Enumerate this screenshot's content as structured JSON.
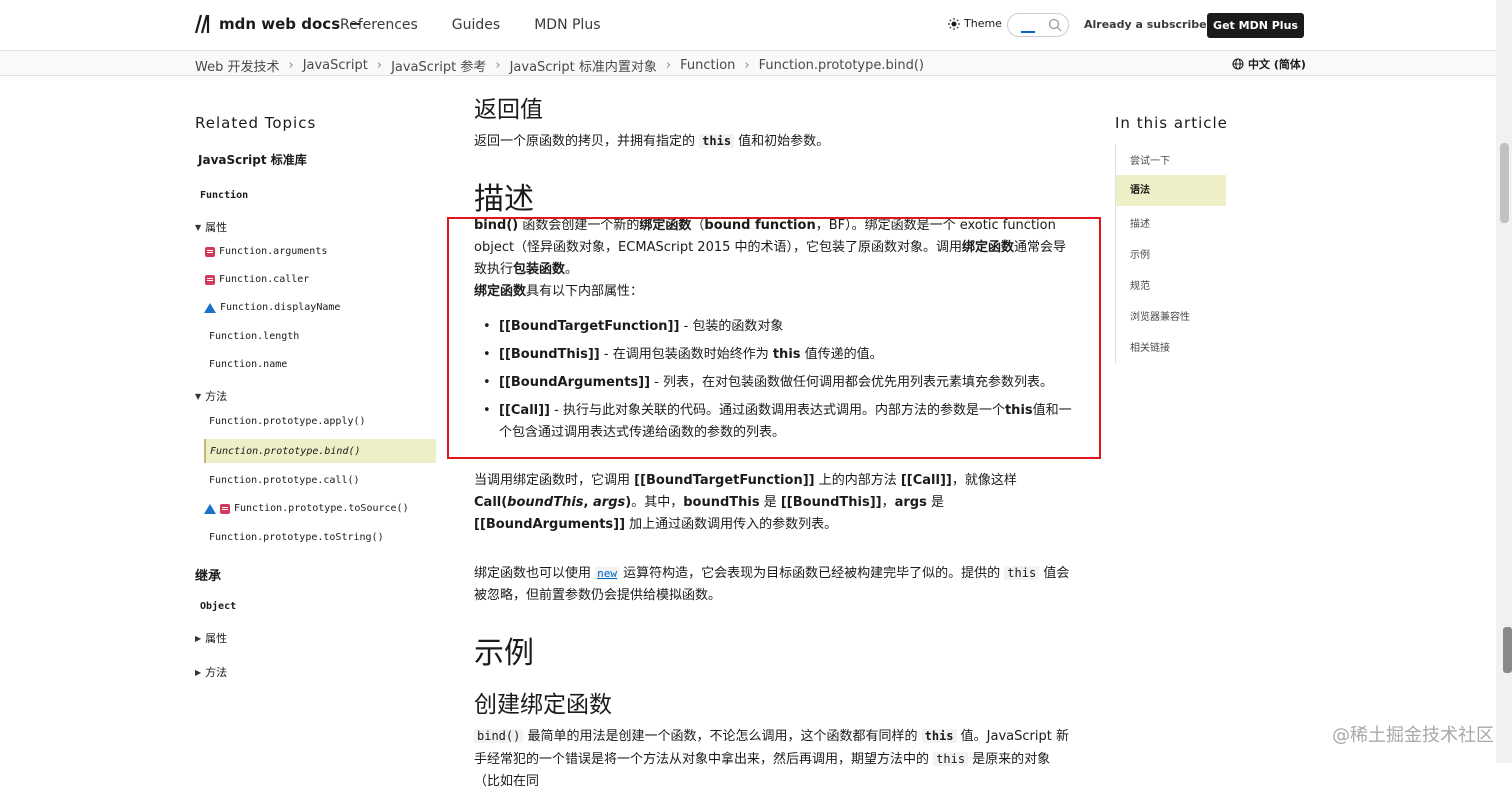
{
  "header": {
    "logo_text": "mdn web docs",
    "nav": [
      "References",
      "Guides",
      "MDN Plus"
    ],
    "theme_label": "Theme",
    "already_subscriber": "Already a subscriber?",
    "get_plus": "Get MDN Plus"
  },
  "breadcrumb": {
    "items": [
      "Web 开发技术",
      "JavaScript",
      "JavaScript 参考",
      "JavaScript 标准内置对象",
      "Function",
      "Function.prototype.bind()"
    ],
    "separator": "›",
    "language": "中文 (简体)"
  },
  "sidebar": {
    "heading": "Related Topics",
    "subheading": "JavaScript 标准库",
    "items": [
      {
        "label": "Function"
      },
      {
        "label": "属性"
      },
      {
        "label": "Function.arguments"
      },
      {
        "label": "Function.caller"
      },
      {
        "label": "Function.displayName"
      },
      {
        "label": "Function.length"
      },
      {
        "label": "Function.name"
      },
      {
        "label": "方法"
      },
      {
        "label": "Function.prototype.apply()"
      },
      {
        "label": "Function.prototype.bind()"
      },
      {
        "label": "Function.prototype.call()"
      },
      {
        "label": "Function.prototype.toSource()"
      },
      {
        "label": "Function.prototype.toString()"
      },
      {
        "label": "继承"
      },
      {
        "label": "Object"
      },
      {
        "label": "属性"
      },
      {
        "label": "方法"
      }
    ]
  },
  "content": {
    "h_return": "返回值",
    "return_pre": "返回一个原函数的拷贝，并拥有指定的 ",
    "return_code": "this",
    "return_post": " 值和初始参数。",
    "h_desc": "描述",
    "desc_p1": {
      "b1": "bind()",
      "t1": " 函数会创建一个新的",
      "b2": "绑定函数",
      "t2": "（",
      "b3": "bound function",
      "t3": "，BF）。绑定函数是一个 exotic function object（怪异函数对象，ECMAScript 2015 中的术语），它包装了原函数对象。调用",
      "b4": "绑定函数",
      "t4": "通常会导致执行",
      "b5": "包装函数",
      "t5": "。"
    },
    "desc_p2_b": "绑定函数",
    "desc_p2_t": "具有以下内部属性：",
    "bullets": [
      {
        "b": "[[BoundTargetFunction]]",
        "t": " - 包装的函数对象"
      },
      {
        "b": "[[BoundThis]]",
        "t": " - 在调用包装函数时始终作为 ",
        "b2": "this",
        "t2": " 值传递的值。"
      },
      {
        "b": "[[BoundArguments]]",
        "t": " - 列表，在对包装函数做任何调用都会优先用列表元素填充参数列表。"
      },
      {
        "b": "[[Call]]",
        "t": " - 执行与此对象关联的代码。通过函数调用表达式调用。内部方法的参数是一个",
        "b2": "this",
        "t2": "值和一个包含通过调用表达式传递给函数的参数的列表。"
      }
    ],
    "call_p": {
      "t1": "当调用绑定函数时，它调用 ",
      "b1": "[[BoundTargetFunction]]",
      "t2": " 上的内部方法 ",
      "b2": "[[Call]]",
      "t3": "，就像这样 ",
      "b3": "Call(",
      "i1": "boundThis",
      "b4": ", ",
      "i2": "args",
      "b5": ")",
      "t4": "。其中，",
      "b6": "boundThis",
      "t5": " 是 ",
      "b7": "[[BoundThis]]",
      "t6": "，",
      "b8": "args",
      "t7": " 是 ",
      "b9": "[[BoundArguments]]",
      "t8": " 加上通过函数调用传入的参数列表。"
    },
    "new_p": {
      "t1": "绑定函数也可以使用 ",
      "link": "new",
      "t2": " 运算符构造，它会表现为目标函数已经被构建完毕了似的。提供的 ",
      "code": "this",
      "t3": " 值会被忽略，但前置参数仍会提供给模拟函数。"
    },
    "h_examples": "示例",
    "h_create": "创建绑定函数",
    "create_p": {
      "code1": "bind()",
      "t1": " 最简单的用法是创建一个函数，不论怎么调用，这个函数都有同样的 ",
      "code2": "this",
      "t2": " 值。JavaScript 新手经常犯的一个错误是将一个方法从对象中拿出来，然后再调用，期望方法中的 ",
      "code3": "this",
      "t3": " 是原来的对象（比如在同"
    }
  },
  "toc": {
    "heading": "In this article",
    "items": [
      "尝试一下",
      "语法",
      "描述",
      "示例",
      "规范",
      "浏览器兼容性",
      "相关链接"
    ],
    "active_index": 1
  },
  "watermark": "@稀土掘金技术社区",
  "colors": {
    "accent": "#0069c2",
    "highlight": "#eeeec7",
    "deprecated": "#d23a5c",
    "experimental": "#1c72c8",
    "annotation_box": "#e0161b"
  }
}
